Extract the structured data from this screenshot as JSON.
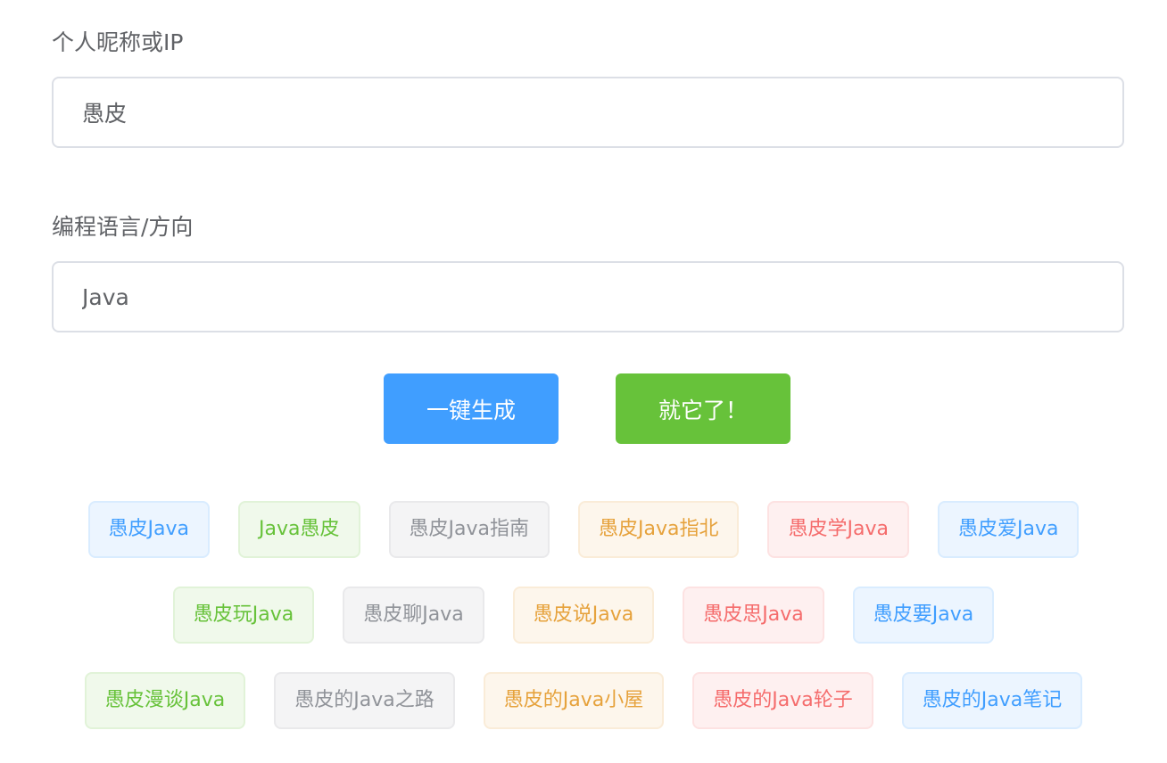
{
  "form": {
    "nickname_label": "个人昵称或IP",
    "nickname_value": "愚皮",
    "language_label": "编程语言/方向",
    "language_value": "Java"
  },
  "buttons": {
    "generate": "一键生成",
    "confirm": "就它了！"
  },
  "colors": {
    "primary": "#409eff",
    "success": "#67c23a",
    "info": "#909399",
    "warning": "#e6a23c",
    "danger": "#f56c6c"
  },
  "tag_rows": [
    [
      {
        "text": "愚皮Java",
        "type": "primary"
      },
      {
        "text": "Java愚皮",
        "type": "success"
      },
      {
        "text": "愚皮Java指南",
        "type": "info"
      },
      {
        "text": "愚皮Java指北",
        "type": "warning"
      },
      {
        "text": "愚皮学Java",
        "type": "danger"
      },
      {
        "text": "愚皮爱Java",
        "type": "primary"
      }
    ],
    [
      {
        "text": "愚皮玩Java",
        "type": "success"
      },
      {
        "text": "愚皮聊Java",
        "type": "info"
      },
      {
        "text": "愚皮说Java",
        "type": "warning"
      },
      {
        "text": "愚皮思Java",
        "type": "danger"
      },
      {
        "text": "愚皮要Java",
        "type": "primary"
      }
    ],
    [
      {
        "text": "愚皮漫谈Java",
        "type": "success"
      },
      {
        "text": "愚皮的Java之路",
        "type": "info"
      },
      {
        "text": "愚皮的Java小屋",
        "type": "warning"
      },
      {
        "text": "愚皮的Java轮子",
        "type": "danger"
      },
      {
        "text": "愚皮的Java笔记",
        "type": "primary"
      }
    ]
  ]
}
